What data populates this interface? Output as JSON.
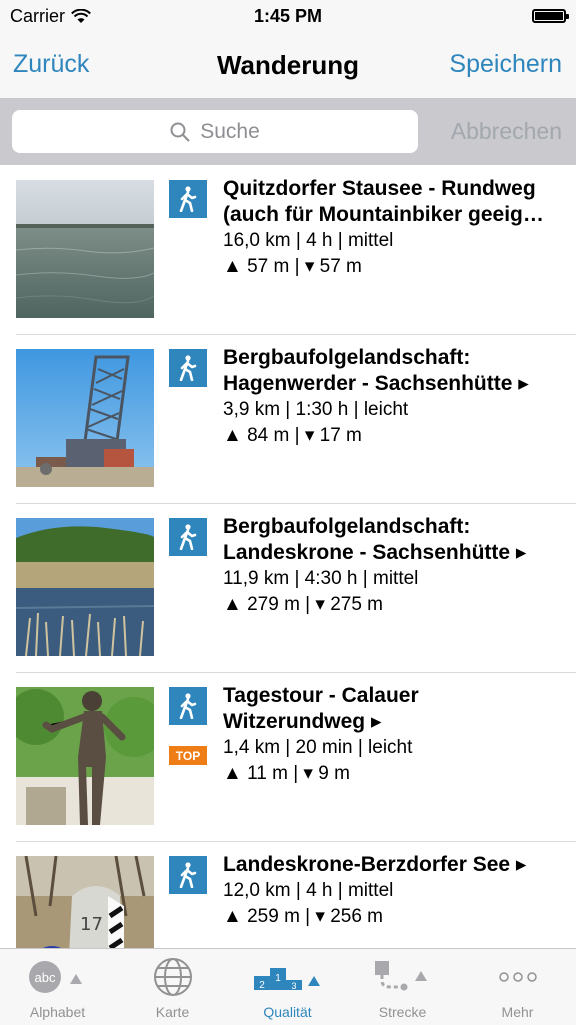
{
  "status": {
    "carrier": "Carrier",
    "time": "1:45 PM"
  },
  "nav": {
    "back": "Zurück",
    "title": "Wanderung",
    "save": "Speichern"
  },
  "search": {
    "placeholder": "Suche",
    "cancel": "Abbrechen"
  },
  "badges": {
    "top": "TOP"
  },
  "tours": [
    {
      "name_line1": "Quitzdorfer Stausee - Rundweg",
      "name_line2": "(auch für Mountainbiker geeig…",
      "stats": "16,0 km | 4 h | mittel",
      "elevation": "▲ 57 m | ▾ 57 m",
      "top": false,
      "image": "lake"
    },
    {
      "name_line1": "Bergbaufolgelandschaft:",
      "name_line2": "Hagenwerder - Sachsenhütte ▸",
      "stats": "3,9 km | 1:30 h | leicht",
      "elevation": "▲ 84 m | ▾ 17 m",
      "top": false,
      "image": "excavator"
    },
    {
      "name_line1": "Bergbaufolgelandschaft:",
      "name_line2": "Landeskrone - Sachsenhütte ▸",
      "stats": "11,9 km | 4:30 h | mittel",
      "elevation": "▲ 279 m | ▾ 275 m",
      "top": false,
      "image": "hill"
    },
    {
      "name_line1": "Tagestour -  Calauer",
      "name_line2": "Witzerundweg ▸",
      "stats": "1,4 km | 20 min | leicht",
      "elevation": "▲ 11 m | ▾ 9 m",
      "top": true,
      "image": "statue"
    },
    {
      "name_line1": "Landeskrone-Berzdorfer See ▸",
      "name_line2": "",
      "stats": "12,0 km | 4 h | mittel",
      "elevation": "▲ 259 m | ▾ 256 m",
      "top": false,
      "image": "milestone"
    }
  ],
  "tabs": [
    {
      "label": "Alphabet",
      "icon": "abc-sort-icon",
      "active": false
    },
    {
      "label": "Karte",
      "icon": "globe-icon",
      "active": false
    },
    {
      "label": "Qualität",
      "icon": "podium-icon",
      "active": true
    },
    {
      "label": "Strecke",
      "icon": "route-icon",
      "active": false
    },
    {
      "label": "Mehr",
      "icon": "more-icon",
      "active": false
    }
  ],
  "colors": {
    "accent": "#2f86bd",
    "top_badge": "#ef7d16",
    "tab_inactive": "#929292"
  }
}
